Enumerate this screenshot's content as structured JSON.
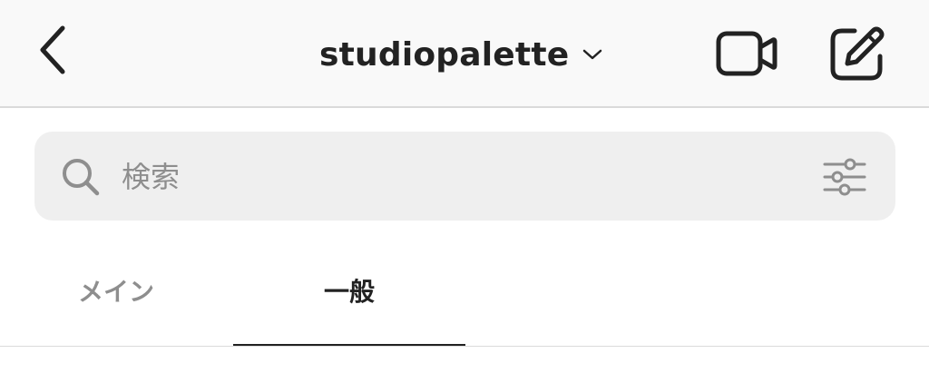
{
  "header": {
    "account_name": "studiopalette",
    "back_icon": "chevron-left-icon",
    "switch_icon": "chevron-down-icon",
    "video_icon": "video-camera-icon",
    "compose_icon": "compose-icon"
  },
  "search": {
    "placeholder": "検索",
    "value": "",
    "icon": "search-icon",
    "filter_icon": "filter-sliders-icon"
  },
  "tabs": [
    {
      "label": "メイン",
      "selected": false
    },
    {
      "label": "一般",
      "selected": true
    }
  ],
  "colors": {
    "text_primary": "#222222",
    "text_secondary": "#8e8e8e",
    "header_bg": "#f9f9f9",
    "search_bg": "#efefef"
  }
}
